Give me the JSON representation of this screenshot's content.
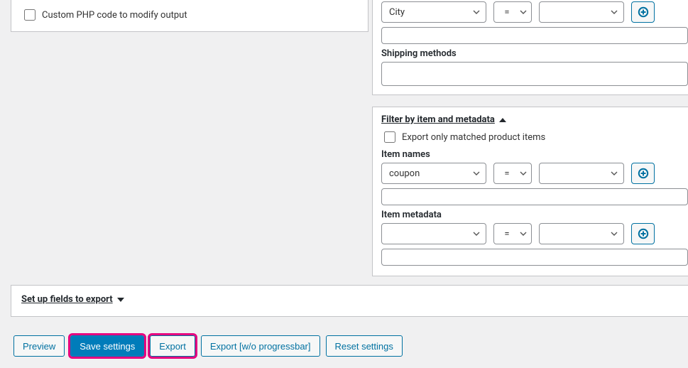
{
  "left": {
    "custom_php_label": "Custom PHP code to modify output"
  },
  "shipping": {
    "city_label": "City",
    "op": "=",
    "methods_label": "Shipping methods"
  },
  "filter_item": {
    "title": "Filter by item and metadata",
    "export_matched_label": "Export only matched product items",
    "item_names_label": "Item names",
    "item_names_value": "coupon",
    "item_names_op": "=",
    "item_metadata_label": "Item metadata",
    "item_metadata_op": "="
  },
  "fields_section": {
    "title": "Set up fields to export"
  },
  "buttons": {
    "preview": "Preview",
    "save": "Save settings",
    "export": "Export",
    "export_no_pb": "Export [w/o progressbar]",
    "reset": "Reset settings"
  }
}
